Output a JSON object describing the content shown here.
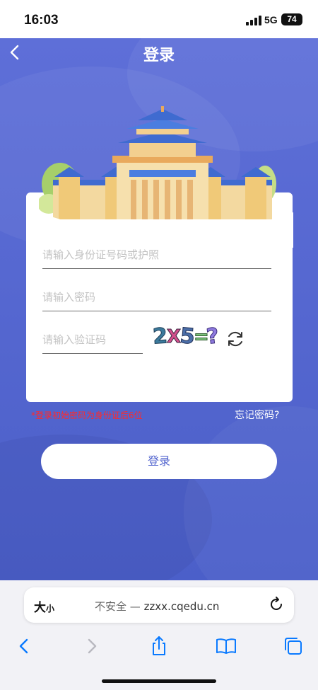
{
  "status_bar": {
    "time": "16:03",
    "network": "5G",
    "battery": "74"
  },
  "header": {
    "title": "登录"
  },
  "form": {
    "id_placeholder": "请输入身份证号码或护照",
    "password_placeholder": "请输入密码",
    "captcha_placeholder": "请输入验证码",
    "captcha_text": "2X5=?",
    "hint": "*登录初始密码为身份证后6位",
    "forgot_password": "忘记密码?",
    "login_button": "登录"
  },
  "browser": {
    "text_size_label": "大",
    "text_size_small": "小",
    "security": "不安全 —",
    "domain": "zzxx.cqedu.cn"
  },
  "icons": {
    "back": "chevron-left-icon",
    "refresh_captcha": "refresh-icon",
    "reload": "reload-icon",
    "nav_back": "chevron-left-icon",
    "nav_forward": "chevron-right-icon",
    "share": "share-icon",
    "bookmarks": "book-icon",
    "tabs": "tabs-icon"
  },
  "colors": {
    "primary": "#5466cf",
    "hint": "#ff2a2a",
    "accent_blue": "#0a7aff"
  }
}
